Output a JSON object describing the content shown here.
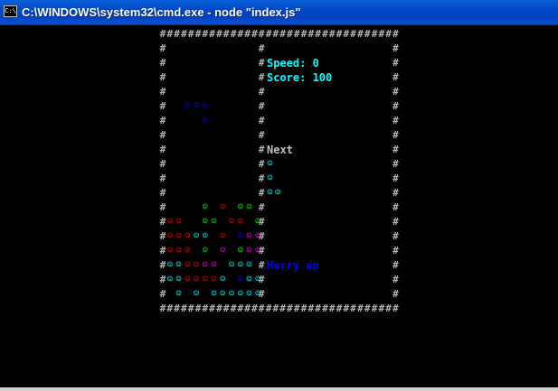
{
  "window": {
    "title": "C:\\WINDOWS\\system32\\cmd.exe - node \"index.js\"",
    "icon_text": "C:\\",
    "icon_name": "cmd-icon"
  },
  "game": {
    "speed_label": "Speed: 0",
    "score_label": "Score: 100",
    "next_label": "Next",
    "hurry_label": "Hurry up",
    "wall_char": "#",
    "block_char": "☺",
    "colors": {
      "C": "#00ffff",
      "B": "#0000ff",
      "G": "#00ff00",
      "R": "#ff0000",
      "M": "#ff00ff",
      "wall": "#b4b4b4"
    },
    "board": [
      "          ",
      "          ",
      "          ",
      "          ",
      "  BBB     ",
      "    B     ",
      "          ",
      "          ",
      "          ",
      "          ",
      "          ",
      "    G R GG",
      "RR  GG RR G",
      "RRRCC R BMM",
      "RRR G M GMM",
      "CCRRMM CCC",
      "CCRRRRC BCC",
      " C C CCCCCC"
    ],
    "next_piece": [
      "C ",
      "C ",
      "CC"
    ]
  }
}
